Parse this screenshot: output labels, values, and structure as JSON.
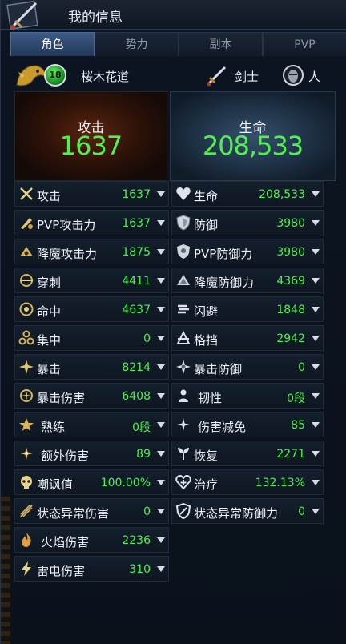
{
  "window": {
    "title": "我的信息"
  },
  "tabs": [
    {
      "label": "角色",
      "active": true
    },
    {
      "label": "势力",
      "active": false
    },
    {
      "label": "副本",
      "active": false
    },
    {
      "label": "PVP",
      "active": false
    }
  ],
  "character": {
    "level": "18",
    "name": "桜木花道",
    "class": "剑士",
    "race": "人"
  },
  "summary": {
    "attack_label": "攻击",
    "attack_value": "1637",
    "hp_label": "生命",
    "hp_value": "208,533"
  },
  "stats_left": [
    {
      "label": "攻击",
      "value": "1637",
      "icon": "crossed-swords-icon"
    },
    {
      "label": "PVP攻击力",
      "value": "1637",
      "icon": "pvp-attack-icon"
    },
    {
      "label": "降魔攻击力",
      "value": "1875",
      "icon": "demon-attack-icon"
    },
    {
      "label": "穿刺",
      "value": "4411",
      "icon": "pierce-icon"
    },
    {
      "label": "命中",
      "value": "4637",
      "icon": "accuracy-icon"
    },
    {
      "label": "集中",
      "value": "0",
      "icon": "focus-icon"
    },
    {
      "label": "暴击",
      "value": "8214",
      "icon": "critical-icon"
    },
    {
      "label": "暴击伤害",
      "value": "6408",
      "icon": "critical-damage-icon"
    },
    {
      "label": "熟练",
      "value": "0段",
      "icon": "mastery-icon"
    },
    {
      "label": "额外伤害",
      "value": "89",
      "icon": "extra-damage-icon"
    },
    {
      "label": "嘲讽值",
      "value": "100.00%",
      "icon": "taunt-skull-icon"
    },
    {
      "label": "状态异常伤害",
      "value": "0",
      "icon": "status-damage-icon"
    },
    {
      "label": "火焰伤害",
      "value": "2236",
      "icon": "flame-icon"
    },
    {
      "label": "雷电伤害",
      "value": "310",
      "icon": "lightning-icon"
    }
  ],
  "stats_right": [
    {
      "label": "生命",
      "value": "208,533",
      "icon": "heart-icon"
    },
    {
      "label": "防御",
      "value": "3980",
      "icon": "shield-icon"
    },
    {
      "label": "PVP防御力",
      "value": "3980",
      "icon": "pvp-defense-icon"
    },
    {
      "label": "降魔防御力",
      "value": "4369",
      "icon": "demon-defense-icon"
    },
    {
      "label": "闪避",
      "value": "1848",
      "icon": "evasion-icon"
    },
    {
      "label": "格挡",
      "value": "2942",
      "icon": "block-icon"
    },
    {
      "label": "暴击防御",
      "value": "0",
      "icon": "critical-defense-icon"
    },
    {
      "label": "韧性",
      "value": "0段",
      "icon": "toughness-icon"
    },
    {
      "label": "伤害减免",
      "value": "85",
      "icon": "damage-reduction-icon"
    },
    {
      "label": "恢复",
      "value": "2271",
      "icon": "recovery-icon"
    },
    {
      "label": "治疗",
      "value": "132.13%",
      "icon": "heal-icon"
    },
    {
      "label": "状态异常防御力",
      "value": "0",
      "icon": "status-defense-icon"
    }
  ],
  "colors": {
    "value_green": "#4cf24a",
    "tab_active": "#3d5a85",
    "panel_attack": "#5a2410",
    "panel_hp": "#35506c"
  }
}
